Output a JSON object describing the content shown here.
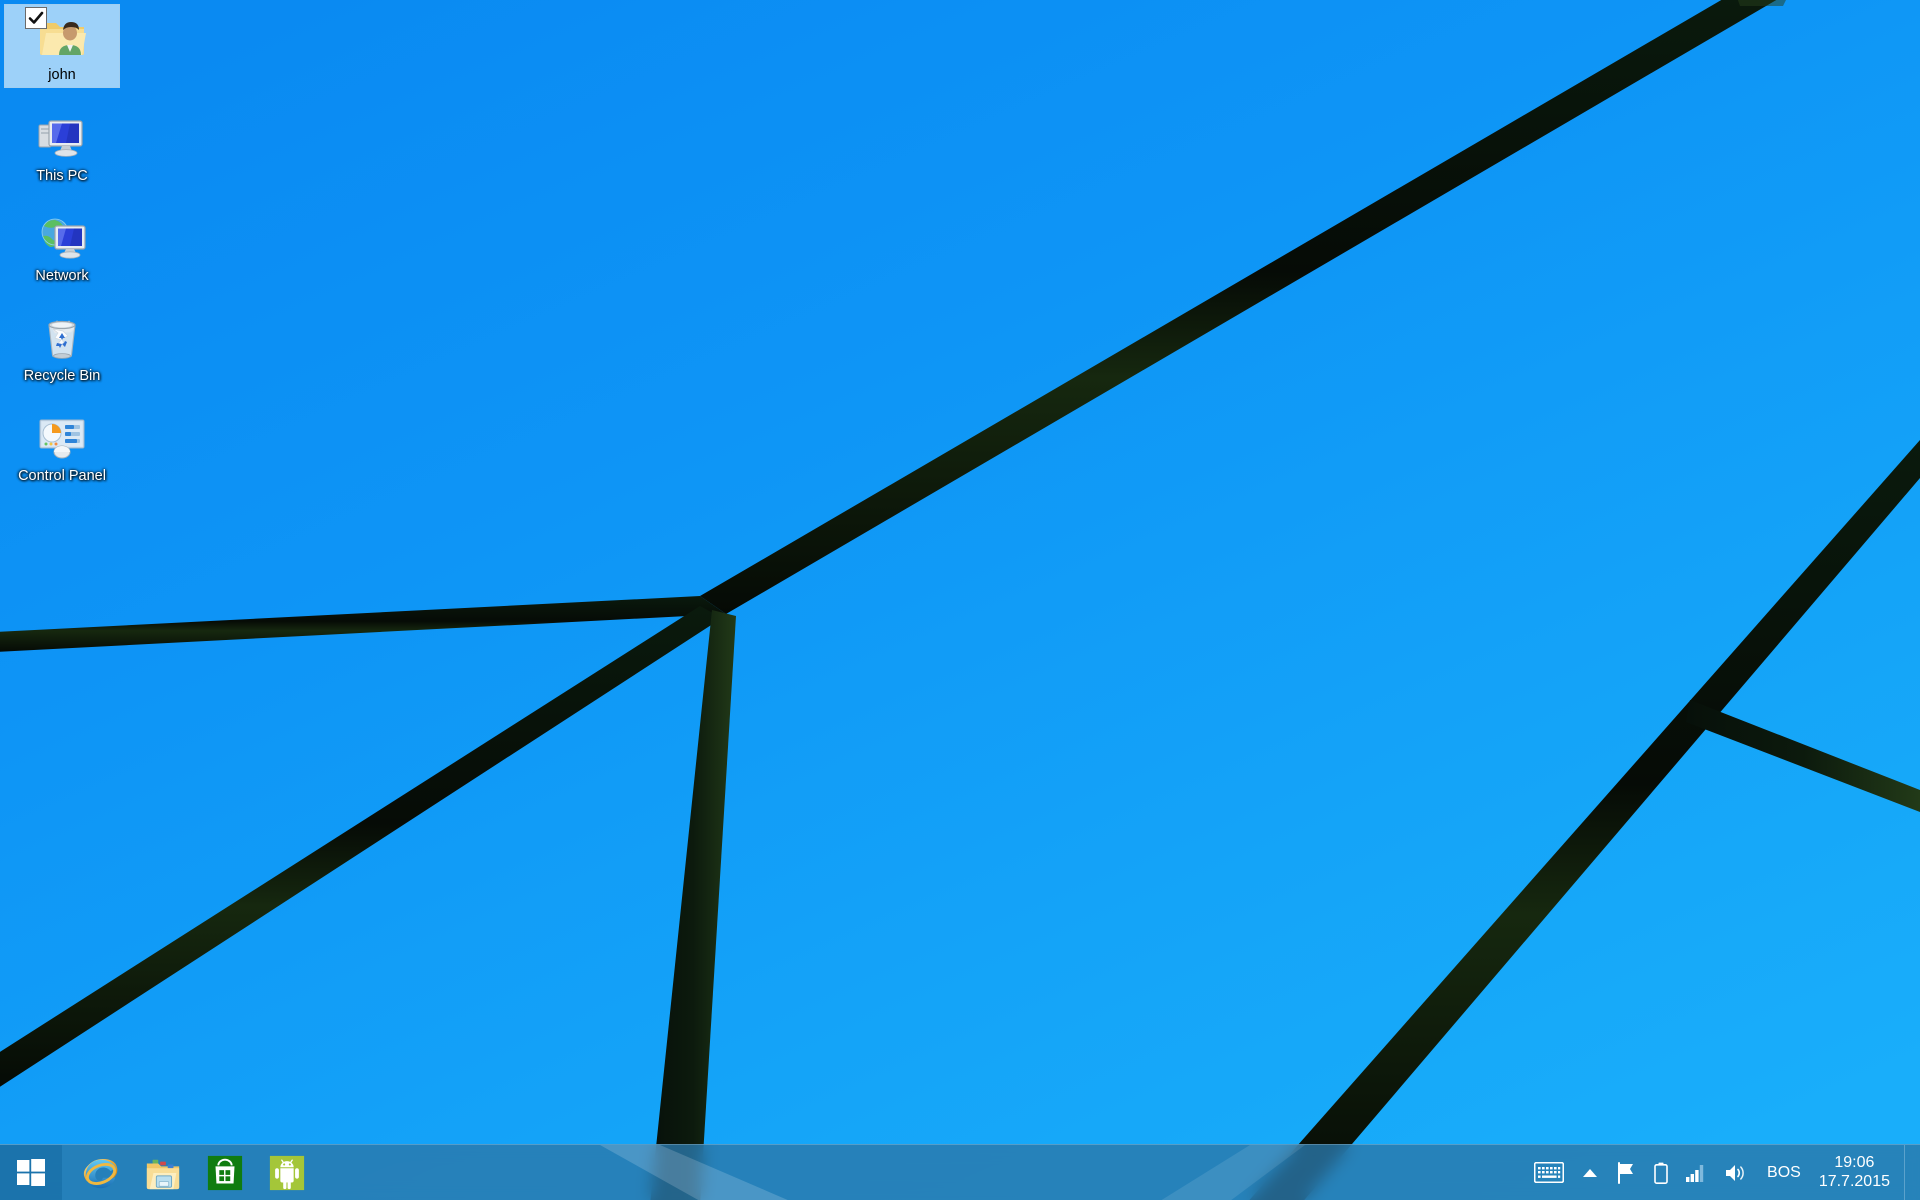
{
  "desktop": {
    "wallpaper": {
      "name": "windows-81-default-beams",
      "sky_top_color": "#0b8cf3",
      "sky_bottom_color": "#17abf9",
      "beam_color": "#0b140c"
    },
    "icons": [
      {
        "label": "john",
        "icon": "user-folder-icon",
        "selected": true,
        "checked": true
      },
      {
        "label": "This PC",
        "icon": "this-pc-icon",
        "selected": false,
        "checked": false
      },
      {
        "label": "Network",
        "icon": "network-icon",
        "selected": false,
        "checked": false
      },
      {
        "label": "Recycle Bin",
        "icon": "recycle-bin-icon",
        "selected": false,
        "checked": false
      },
      {
        "label": "Control Panel",
        "icon": "control-panel-icon",
        "selected": false,
        "checked": false
      }
    ]
  },
  "taskbar": {
    "start_label": "Start",
    "apps": [
      {
        "label": "Internet Explorer",
        "icon": "internet-explorer-icon"
      },
      {
        "label": "File Explorer",
        "icon": "file-explorer-icon"
      },
      {
        "label": "Store",
        "icon": "windows-store-icon"
      },
      {
        "label": "Android App Player",
        "icon": "android-icon"
      }
    ],
    "tray": {
      "items": [
        {
          "label": "Touch keyboard",
          "icon": "keyboard-icon"
        },
        {
          "label": "Show hidden icons",
          "icon": "chevron-up-icon"
        },
        {
          "label": "Action Center",
          "icon": "flag-icon"
        },
        {
          "label": "Battery",
          "icon": "battery-icon"
        },
        {
          "label": "Network",
          "icon": "signal-bars-icon"
        },
        {
          "label": "Volume",
          "icon": "speaker-icon"
        }
      ],
      "language": "BOS",
      "time": "19:06",
      "date": "17.7.2015"
    }
  }
}
